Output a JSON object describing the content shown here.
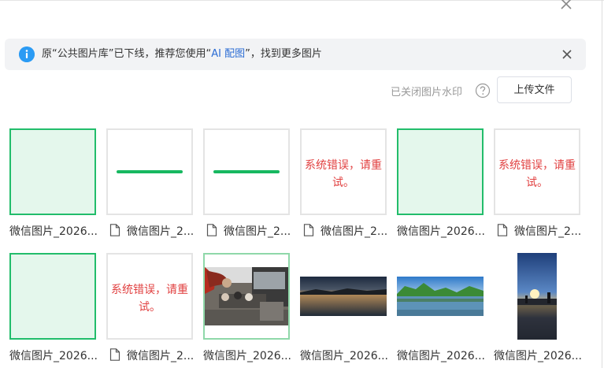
{
  "dialog": {
    "close_icon": "close-icon"
  },
  "notice": {
    "icon": "info-icon",
    "text_before": "原“公共图片库”已下线，推荐您使用“",
    "link_text": "AI 配图",
    "text_after": "”，找到更多图片",
    "close_icon": "close-icon",
    "accent_color": "#2b9bf4"
  },
  "toolbar": {
    "watermark_label": "已关闭图片水印",
    "help_icon": "question-circle-icon",
    "upload_label": "上传文件"
  },
  "images": [
    {
      "caption": "微信图片_2026...",
      "kind": "green",
      "file_icon": false
    },
    {
      "caption": "微信图片_2...",
      "kind": "bar",
      "file_icon": true
    },
    {
      "caption": "微信图片_2...",
      "kind": "bar",
      "file_icon": true
    },
    {
      "caption": "微信图片_2...",
      "kind": "error",
      "error_text": "系统错误，请重试。",
      "file_icon": true
    },
    {
      "caption": "微信图片_2026...",
      "kind": "green",
      "file_icon": false
    },
    {
      "caption": "微信图片_2...",
      "kind": "error",
      "error_text": "系统错误，请重试。",
      "file_icon": true
    },
    {
      "caption": "微信图片_2026...",
      "kind": "green",
      "file_icon": false
    },
    {
      "caption": "微信图片_2...",
      "kind": "error",
      "error_text": "系统错误，请重试。",
      "file_icon": true
    },
    {
      "caption": "微信图片_2026...",
      "kind": "photo-patio",
      "file_icon": false
    },
    {
      "caption": "微信图片_2026...",
      "kind": "photo-night-lake",
      "file_icon": false
    },
    {
      "caption": "微信图片_2026...",
      "kind": "photo-day-lake",
      "file_icon": false
    },
    {
      "caption": "微信图片_2026...",
      "kind": "photo-sunset-tall",
      "file_icon": false
    }
  ],
  "colors": {
    "success_green": "#22bd6b",
    "error_red": "#e14141",
    "link_blue": "#2b6cd4"
  }
}
